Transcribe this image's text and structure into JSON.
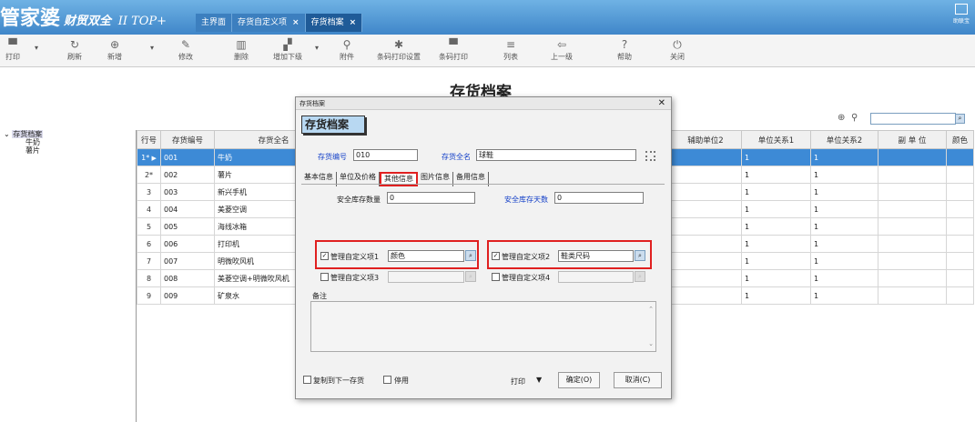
{
  "app": {
    "logo": "管家婆",
    "edition": "财贸双全",
    "version": "II TOP+",
    "corner_label": "助联宝"
  },
  "tabs": [
    {
      "label": "主界面",
      "closable": false
    },
    {
      "label": "存货自定义项",
      "closable": true
    },
    {
      "label": "存货档案",
      "closable": true,
      "active": true
    }
  ],
  "toolbar": {
    "print": "打印",
    "refresh": "刷新",
    "add": "新增",
    "edit": "修改",
    "delete": "删除",
    "add_child": "增加下级",
    "attach": "附件",
    "barcode_setup": "条码打印设置",
    "barcode_print": "条码打印",
    "list": "列表",
    "up": "上一级",
    "help": "帮助",
    "close": "关闭"
  },
  "page_title": "存货档案",
  "tree": {
    "root": "存货档案",
    "children": [
      "牛奶",
      "薯片"
    ]
  },
  "grid": {
    "headers": {
      "row": "行号",
      "code": "存货编号",
      "name": "存货全名",
      "aux_unit": "辅助单位2",
      "rel1": "单位关系1",
      "rel2": "单位关系2",
      "sub_unit": "副 单 位",
      "color": "颜色"
    },
    "rows": [
      {
        "no": "1*",
        "code": "001",
        "name": "牛奶",
        "rel1": "1",
        "rel2": "1"
      },
      {
        "no": "2*",
        "code": "002",
        "name": "薯片",
        "rel1": "1",
        "rel2": "1"
      },
      {
        "no": "3",
        "code": "003",
        "name": "新兴手机",
        "rel1": "1",
        "rel2": "1"
      },
      {
        "no": "4",
        "code": "004",
        "name": "美菱空调",
        "rel1": "1",
        "rel2": "1"
      },
      {
        "no": "5",
        "code": "005",
        "name": "海线冰箱",
        "rel1": "1",
        "rel2": "1"
      },
      {
        "no": "6",
        "code": "006",
        "name": "打印机",
        "rel1": "1",
        "rel2": "1"
      },
      {
        "no": "7",
        "code": "007",
        "name": "明微吹风机",
        "rel1": "1",
        "rel2": "1"
      },
      {
        "no": "8",
        "code": "008",
        "name": "美菱空调+明微吹风机",
        "rel1": "1",
        "rel2": "1"
      },
      {
        "no": "9",
        "code": "009",
        "name": "矿泉水",
        "rel1": "1",
        "rel2": "1"
      }
    ]
  },
  "dialog": {
    "window_title": "存货档案",
    "header": "存货档案",
    "code_label": "存货编号",
    "code_value": "010",
    "name_label": "存货全名",
    "name_value": "球鞋",
    "tabs": [
      "基本信息",
      "单位及价格",
      "其他信息",
      "图片信息",
      "备用信息"
    ],
    "safety_qty_label": "安全库存数量",
    "safety_qty_value": "0",
    "safety_days_label": "安全库存天数",
    "safety_days_value": "0",
    "custom1_label": "管理自定义项1",
    "custom1_value": "颜色",
    "custom2_label": "管理自定义项2",
    "custom2_value": "鞋类尺码",
    "custom3_label": "管理自定义项3",
    "custom3_value": "",
    "custom4_label": "管理自定义项4",
    "custom4_value": "",
    "memo_label": "备注",
    "copy_label": "复制到下一存货",
    "disable_label": "停用",
    "print_label": "打印",
    "confirm_label": "确定(O)",
    "cancel_label": "取消(C)"
  },
  "colors": {
    "accent": "#3f86c9",
    "selected_row": "#3d8ad6",
    "highlight": "#e02020",
    "label_blue": "#1440c8"
  }
}
